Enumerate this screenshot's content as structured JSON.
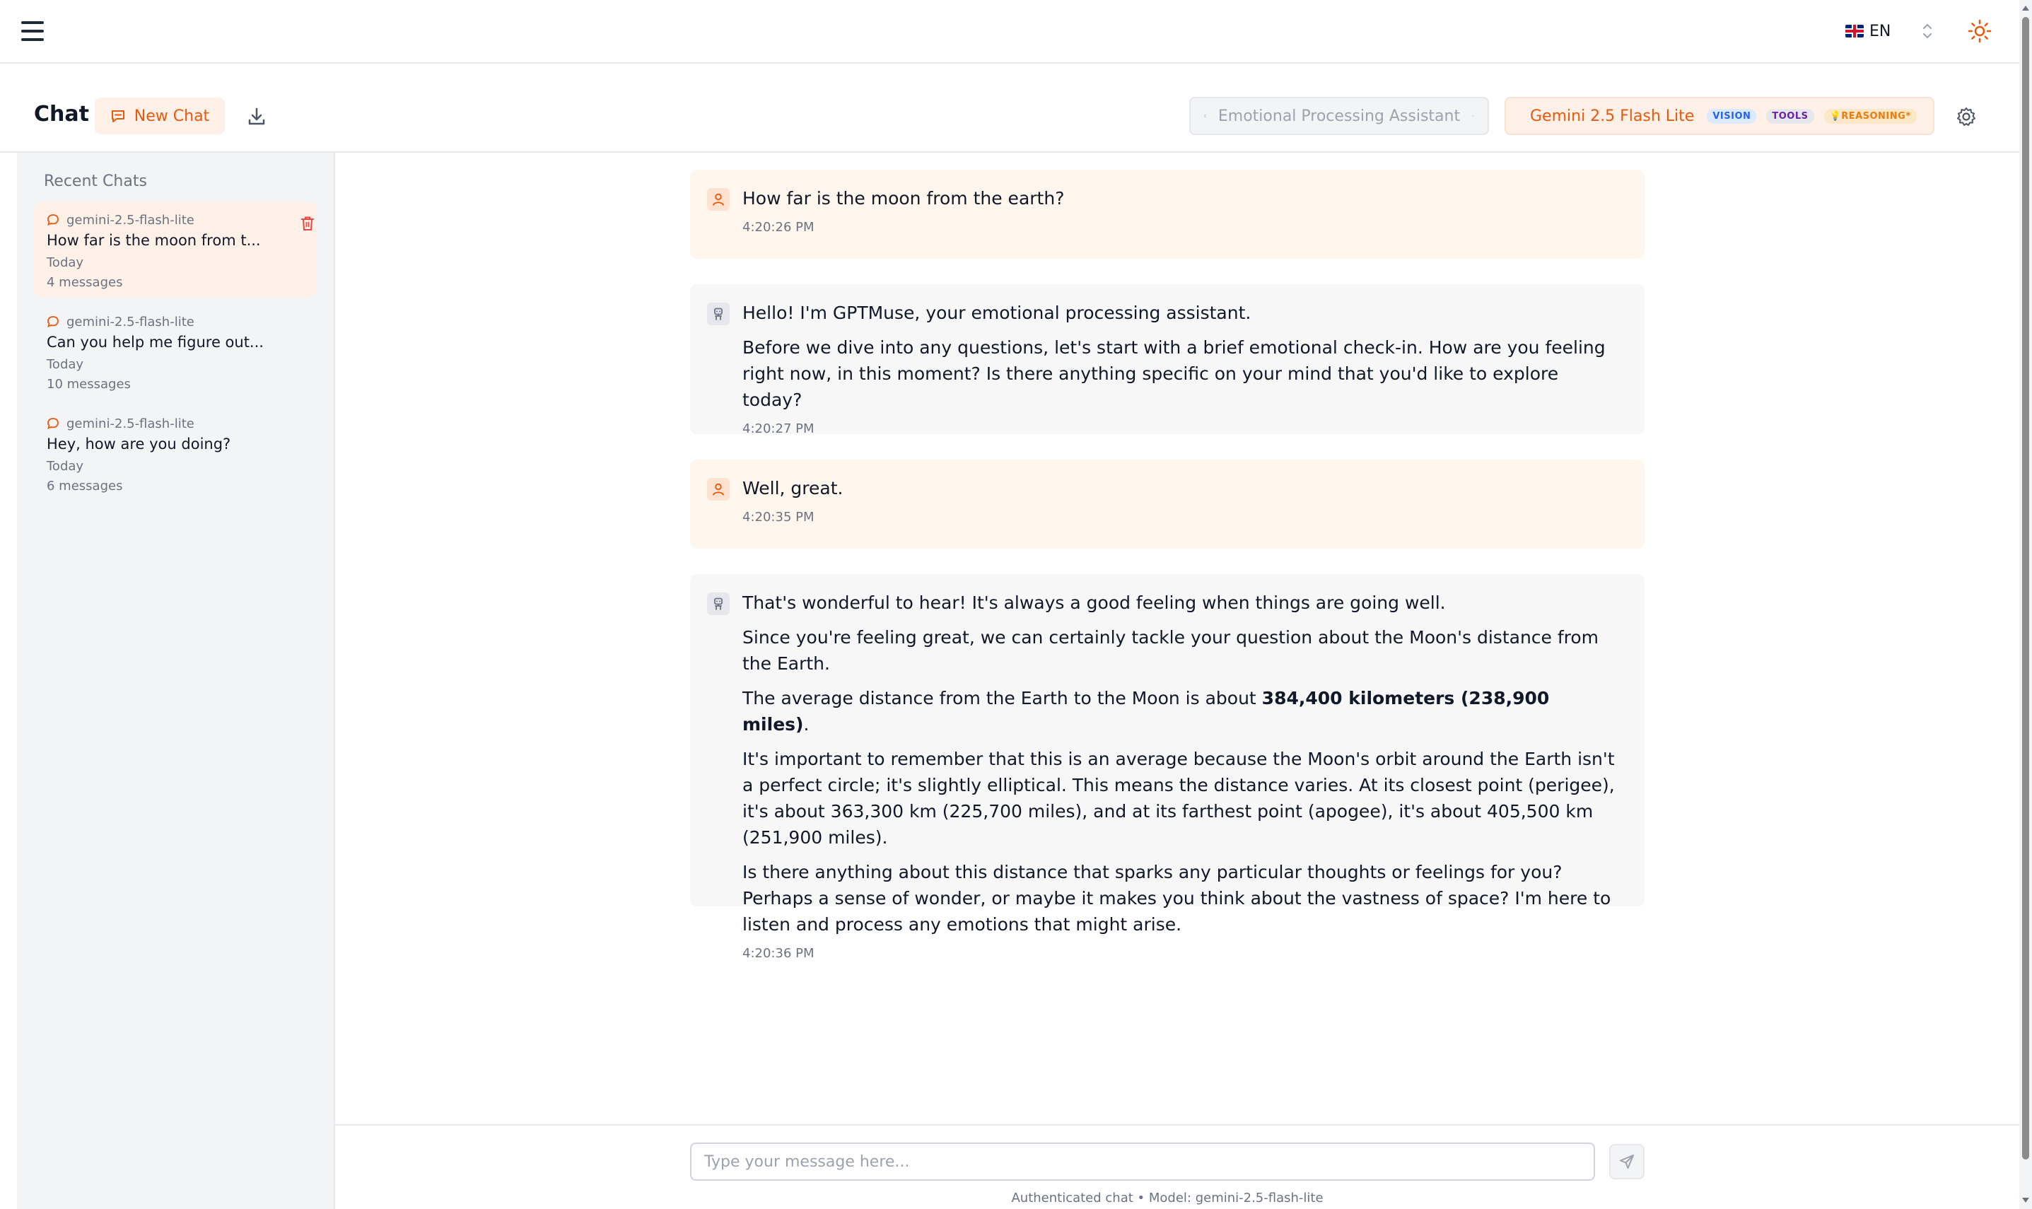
{
  "topbar": {
    "menu_icon": "hamburger-menu-icon",
    "language": "EN",
    "language_flag": "uk-flag-icon",
    "theme_icon": "sun-icon",
    "accent_color": "#ea580c"
  },
  "header": {
    "title": "Chat",
    "new_chat_label": "New Chat",
    "persona": "Emotional Processing Assistant",
    "model": {
      "label": "Gemini 2.5 Flash Lite",
      "badges": [
        "VISION",
        "TOOLS",
        "REASONING*"
      ]
    }
  },
  "sidebar": {
    "heading": "Recent Chats",
    "chats": [
      {
        "model": "gemini-2.5-flash-lite",
        "title": "How far is the moon from t...",
        "date": "Today",
        "count": "4 messages",
        "active": true
      },
      {
        "model": "gemini-2.5-flash-lite",
        "title": "Can you help me figure out...",
        "date": "Today",
        "count": "10 messages",
        "active": false
      },
      {
        "model": "gemini-2.5-flash-lite",
        "title": "Hey, how are you doing?",
        "date": "Today",
        "count": "6 messages",
        "active": false
      }
    ]
  },
  "messages": [
    {
      "role": "user",
      "paragraphs": [
        "How far is the moon from the earth?"
      ],
      "time": "4:20:26 PM"
    },
    {
      "role": "assistant",
      "paragraphs": [
        "Hello! I'm GPTMuse, your emotional processing assistant.",
        "Before we dive into any questions, let's start with a brief emotional check-in. How are you feeling right now, in this moment? Is there anything specific on your mind that you'd like to explore today?"
      ],
      "time": "4:20:27 PM"
    },
    {
      "role": "user",
      "paragraphs": [
        "Well, great."
      ],
      "time": "4:20:35 PM"
    },
    {
      "role": "assistant",
      "paragraphs": [
        "That's wonderful to hear! It's always a good feeling when things are going well.",
        "Since you're feeling great, we can certainly tackle your question about the Moon's distance from the Earth."
      ],
      "distance_sentence": {
        "before": "The average distance from the Earth to the Moon is about ",
        "bold": "384,400 kilometers (238,900 miles)",
        "after": "."
      },
      "paragraphs_after": [
        "It's important to remember that this is an average because the Moon's orbit around the Earth isn't a perfect circle; it's slightly elliptical. This means the distance varies. At its closest point (perigee), it's about 363,300 km (225,700 miles), and at its farthest point (apogee), it's about 405,500 km (251,900 miles).",
        "Is there anything about this distance that sparks any particular thoughts or feelings for you? Perhaps a sense of wonder, or maybe it makes you think about the vastness of space? I'm here to listen and process any emotions that might arise."
      ],
      "time": "4:20:36 PM"
    }
  ],
  "composer": {
    "placeholder": "Type your message here...",
    "value": "",
    "footer_prefix": "Authenticated chat • Model: ",
    "footer_model": "gemini-2.5-flash-lite"
  }
}
